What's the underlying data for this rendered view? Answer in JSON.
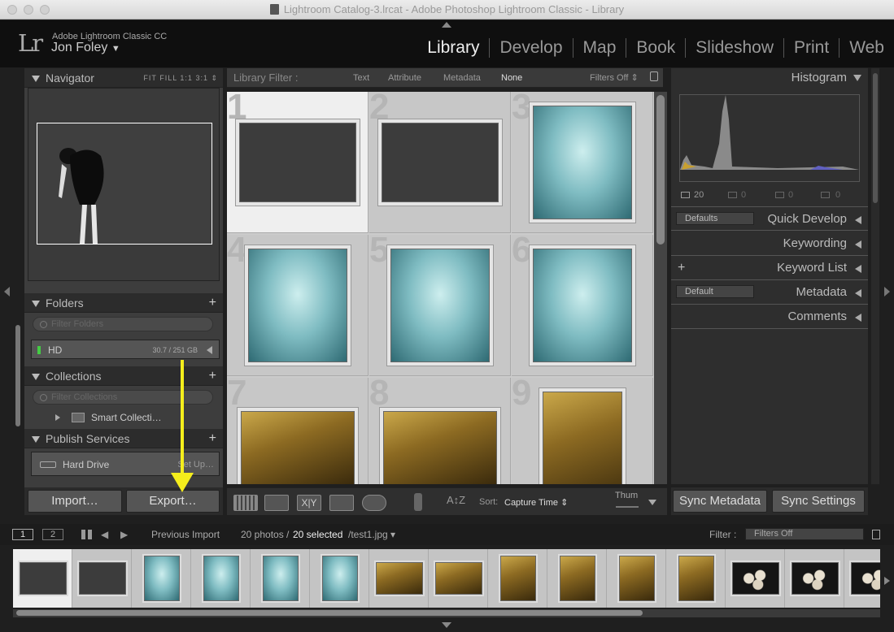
{
  "window": {
    "title": "Lightroom Catalog-3.lrcat - Adobe Photoshop Lightroom Classic - Library"
  },
  "identity": {
    "logo": "Lr",
    "app": "Adobe Lightroom Classic CC",
    "user": "Jon Foley",
    "user_chevron": "▼"
  },
  "modules": [
    "Library",
    "Develop",
    "Map",
    "Book",
    "Slideshow",
    "Print",
    "Web"
  ],
  "active_module": "Library",
  "left": {
    "navigator": {
      "title": "Navigator",
      "options": "FIT  FILL  1:1  3:1 ⇕"
    },
    "folders": {
      "title": "Folders",
      "filter_placeholder": "Filter Folders",
      "volume": "HD",
      "volume_usage": "30.7 / 251 GB"
    },
    "collections": {
      "title": "Collections",
      "filter_placeholder": "Filter Collections",
      "item": "Smart Collecti…"
    },
    "publish": {
      "title": "Publish Services",
      "item": "Hard Drive",
      "setup": "Set Up…"
    },
    "import_label": "Import…",
    "export_label": "Export…"
  },
  "filterbar": {
    "title": "Library Filter :",
    "text": "Text",
    "attribute": "Attribute",
    "metadata": "Metadata",
    "none": "None",
    "filters_off": "Filters Off ⇕"
  },
  "grid": {
    "cells": [
      {
        "num": "1",
        "kind": "dark",
        "selected": true
      },
      {
        "num": "2",
        "kind": "dark",
        "selected": false
      },
      {
        "num": "3",
        "kind": "aqua",
        "selected": false
      },
      {
        "num": "4",
        "kind": "aqua",
        "selected": false
      },
      {
        "num": "5",
        "kind": "aqua",
        "selected": false
      },
      {
        "num": "6",
        "kind": "aqua",
        "selected": false
      },
      {
        "num": "7",
        "kind": "forest",
        "selected": false
      },
      {
        "num": "8",
        "kind": "forest",
        "selected": false
      },
      {
        "num": "9",
        "kind": "forest",
        "selected": false
      }
    ]
  },
  "toolbar": {
    "sort_label": "Sort:",
    "sort_value": "Capture Time ⇕",
    "thumb_label": "Thum"
  },
  "right": {
    "histogram": {
      "title": "Histogram",
      "stats": [
        "20",
        "0",
        "0",
        "0"
      ]
    },
    "quick_develop": {
      "title": "Quick Develop",
      "preset": "Defaults"
    },
    "keywording": {
      "title": "Keywording"
    },
    "keyword_list": {
      "title": "Keyword List"
    },
    "metadata": {
      "title": "Metadata",
      "preset": "Default"
    },
    "comments": {
      "title": "Comments"
    },
    "sync_metadata": "Sync Metadata",
    "sync_settings": "Sync Settings"
  },
  "filmstrip": {
    "page1": "1",
    "page2": "2",
    "source": "Previous Import",
    "count_prefix": "20 photos /",
    "count_selected": "20 selected",
    "file": "/test1.jpg ▾",
    "filter_label": "Filter :",
    "filter_value": "Filters Off",
    "thumbs": [
      "dark",
      "dark",
      "aqua",
      "aqua",
      "aqua",
      "aqua",
      "forest",
      "forest",
      "forest",
      "forest",
      "forest",
      "forest",
      "eggs",
      "eggs",
      "eggs"
    ]
  },
  "colors": {
    "annotation_arrow": "#f5ee1c",
    "aqua": "#7fbcc2",
    "forest": "#b08a30"
  }
}
